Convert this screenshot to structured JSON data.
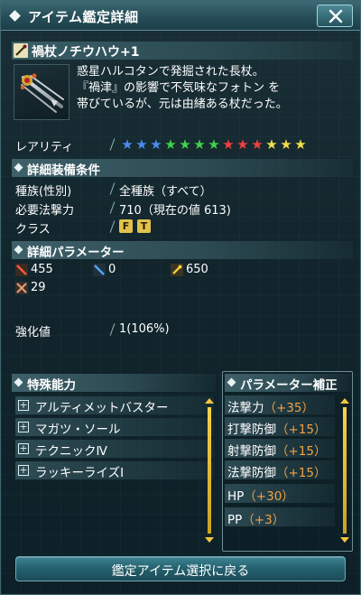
{
  "window": {
    "title": "アイテム鑑定詳細"
  },
  "item": {
    "name": "禍杖ノチウハウ+1",
    "description": "惑星ハルコタンで発掘された長杖。\n『禍津』の影響で不気味なフォトン を\n帯びているが、元は由緒ある杖だった。"
  },
  "rarity": {
    "label": "レアリティ",
    "star_count": 13,
    "star_colors": [
      "#4a8cf0",
      "#4a8cf0",
      "#4a8cf0",
      "#3fd24a",
      "#3fd24a",
      "#3fd24a",
      "#3fd24a",
      "#f04040",
      "#f04040",
      "#f04040",
      "#f2de4a",
      "#f2de4a",
      "#f2de4a"
    ]
  },
  "equip_conditions": {
    "header": "詳細装備条件",
    "race_label": "種族(性別)",
    "race_value": "全種族（すべて）",
    "req_label": "必要法撃力",
    "req_value": "710（現在の値 613)",
    "class_label": "クラス",
    "class_icons": [
      "force-class-icon",
      "techter-class-icon"
    ]
  },
  "params": {
    "header": "詳細パラメーター",
    "attack": "455",
    "ranged": "0",
    "tech": "650",
    "other": "29"
  },
  "enhance": {
    "label": "強化値",
    "value": "1(106%)"
  },
  "abilities": {
    "header": "特殊能力",
    "items": [
      "アルティメットバスター",
      "マガツ・ソール",
      "テクニックⅣ",
      "ラッキーライズⅠ"
    ]
  },
  "param_bonus": {
    "header": "パラメーター補正",
    "items": [
      {
        "name": "法撃力",
        "bonus": "（+35）"
      },
      {
        "name": "打撃防御",
        "bonus": "（+15）"
      },
      {
        "name": "射撃防御",
        "bonus": "（+15）"
      },
      {
        "name": "法撃防御",
        "bonus": "（+15）"
      },
      {
        "name": "HP",
        "bonus": "（+30）"
      },
      {
        "name": "PP",
        "bonus": "（+3）"
      }
    ]
  },
  "footer": {
    "back_label": "鑑定アイテム選択に戻る"
  }
}
